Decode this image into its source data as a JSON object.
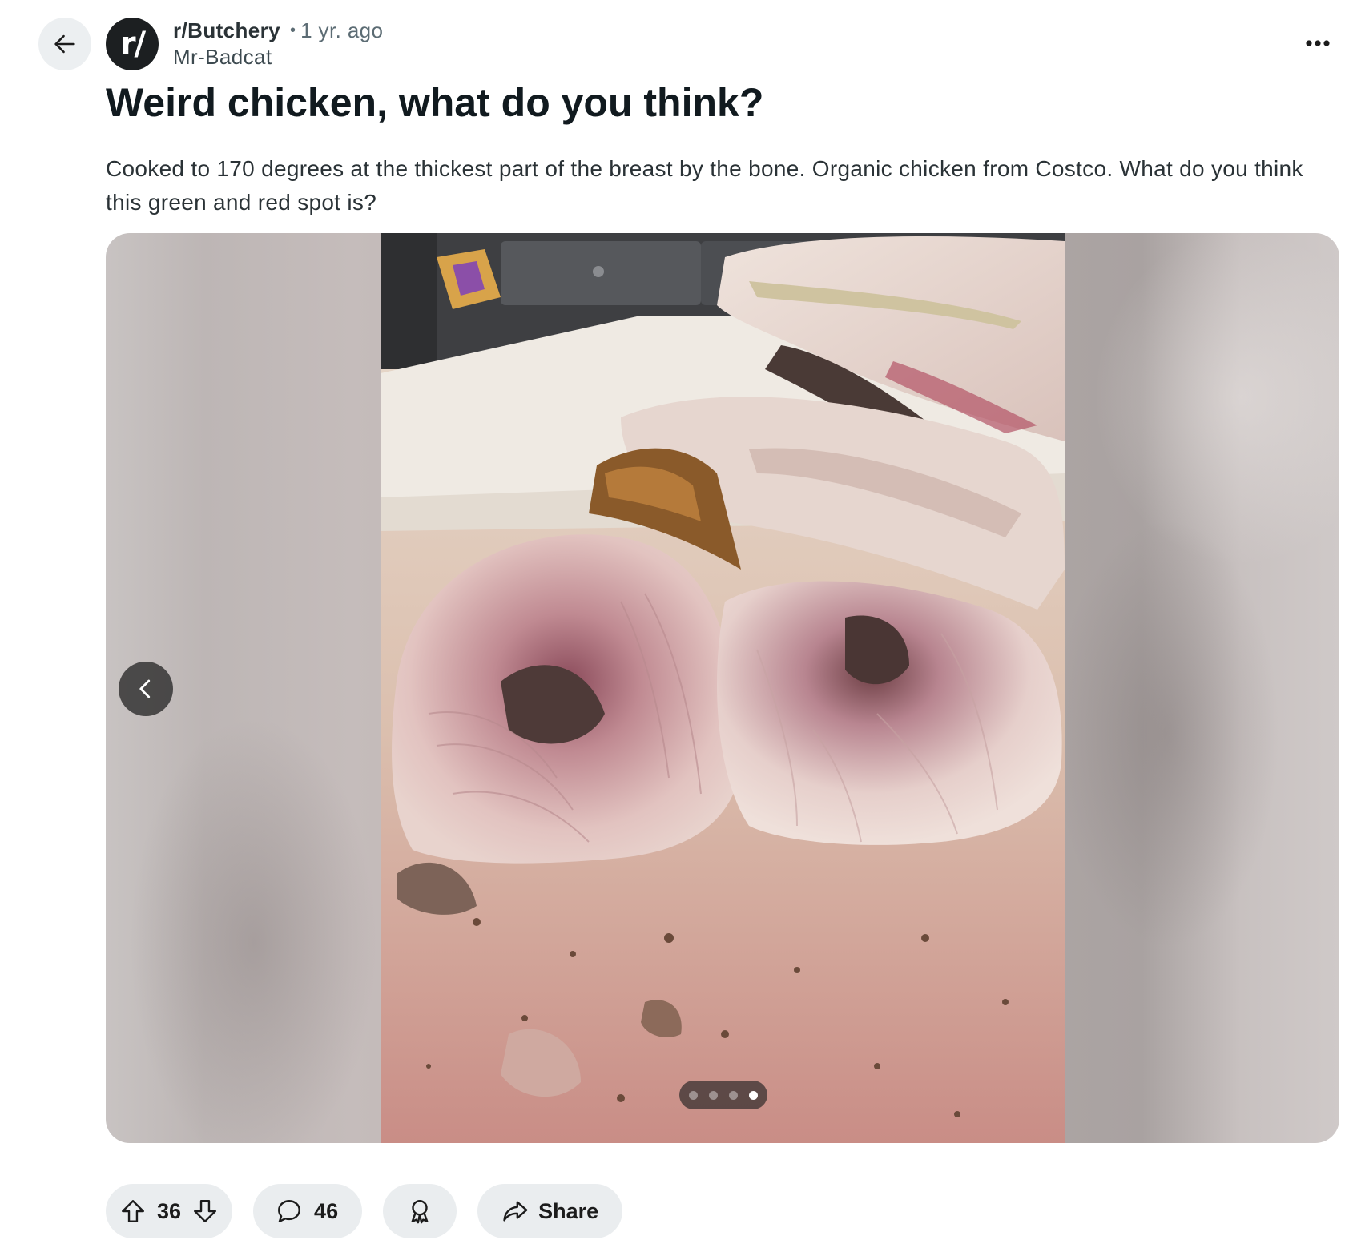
{
  "header": {
    "avatar_text": "r/",
    "subreddit": "r/Butchery",
    "separator": "•",
    "time": "1 yr. ago",
    "author": "Mr-Badcat"
  },
  "icons": {
    "back": "arrow-left-icon",
    "more": "more-horizontal-icon",
    "prev": "chevron-left-icon",
    "upvote": "arrow-up-icon",
    "downvote": "arrow-down-icon",
    "comments": "speech-bubble-icon",
    "award": "award-ribbon-icon",
    "share": "share-arrow-icon"
  },
  "post": {
    "title": "Weird chicken, what do you think?",
    "body": "Cooked to 170 degrees at the thickest part of the breast by the bone. Organic chicken from Costco. What do you think this green and red spot is?"
  },
  "gallery": {
    "page_count": 4,
    "active_page": 4
  },
  "actions": {
    "score": "36",
    "comments": "46",
    "share_label": "Share"
  },
  "colors": {
    "pill_bg": "#eaedef",
    "back_bg": "#eceff1",
    "avatar_bg": "#1c1f21",
    "text_primary": "#111a1f",
    "text_secondary": "#5c6c74"
  }
}
